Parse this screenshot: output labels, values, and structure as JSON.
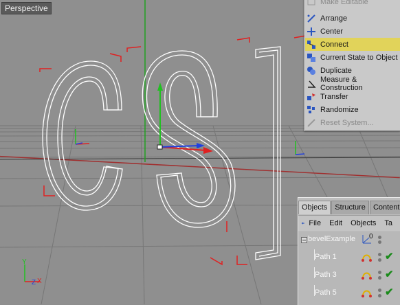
{
  "viewport": {
    "label": "Perspective"
  },
  "context_menu": {
    "items": [
      {
        "label": "Make Editable",
        "icon": "make-editable-icon",
        "state": "disabled"
      },
      {
        "label": "Arrange",
        "icon": "arrange-icon",
        "state": "normal"
      },
      {
        "label": "Center",
        "icon": "center-icon",
        "state": "normal"
      },
      {
        "label": "Connect",
        "icon": "connect-icon",
        "state": "highlighted"
      },
      {
        "label": "Current State to Object",
        "icon": "current-state-icon",
        "state": "normal"
      },
      {
        "label": "Duplicate",
        "icon": "duplicate-icon",
        "state": "normal"
      },
      {
        "label": "Measure & Construction",
        "icon": "measure-icon",
        "state": "normal"
      },
      {
        "label": "Transfer",
        "icon": "transfer-icon",
        "state": "normal"
      },
      {
        "label": "Randomize",
        "icon": "randomize-icon",
        "state": "normal"
      },
      {
        "label": "Reset System...",
        "icon": "reset-system-icon",
        "state": "disabled"
      }
    ]
  },
  "objects_manager": {
    "tabs": [
      "Objects",
      "Structure",
      "Content"
    ],
    "active_tab": "Objects",
    "menu": [
      "File",
      "Edit",
      "Objects",
      "Ta"
    ],
    "tree": {
      "root": {
        "name": "bevelExample",
        "badge": "0"
      },
      "children": [
        {
          "name": "Path 1"
        },
        {
          "name": "Path 3"
        },
        {
          "name": "Path 5"
        }
      ]
    }
  },
  "colors": {
    "viewport_bg": "#8e8e8e",
    "highlight": "#e1d35a",
    "spline": "#ffffff",
    "bracket": "#e02020",
    "axis_x": "#e02020",
    "axis_y": "#20c020",
    "axis_z": "#2040e0"
  }
}
